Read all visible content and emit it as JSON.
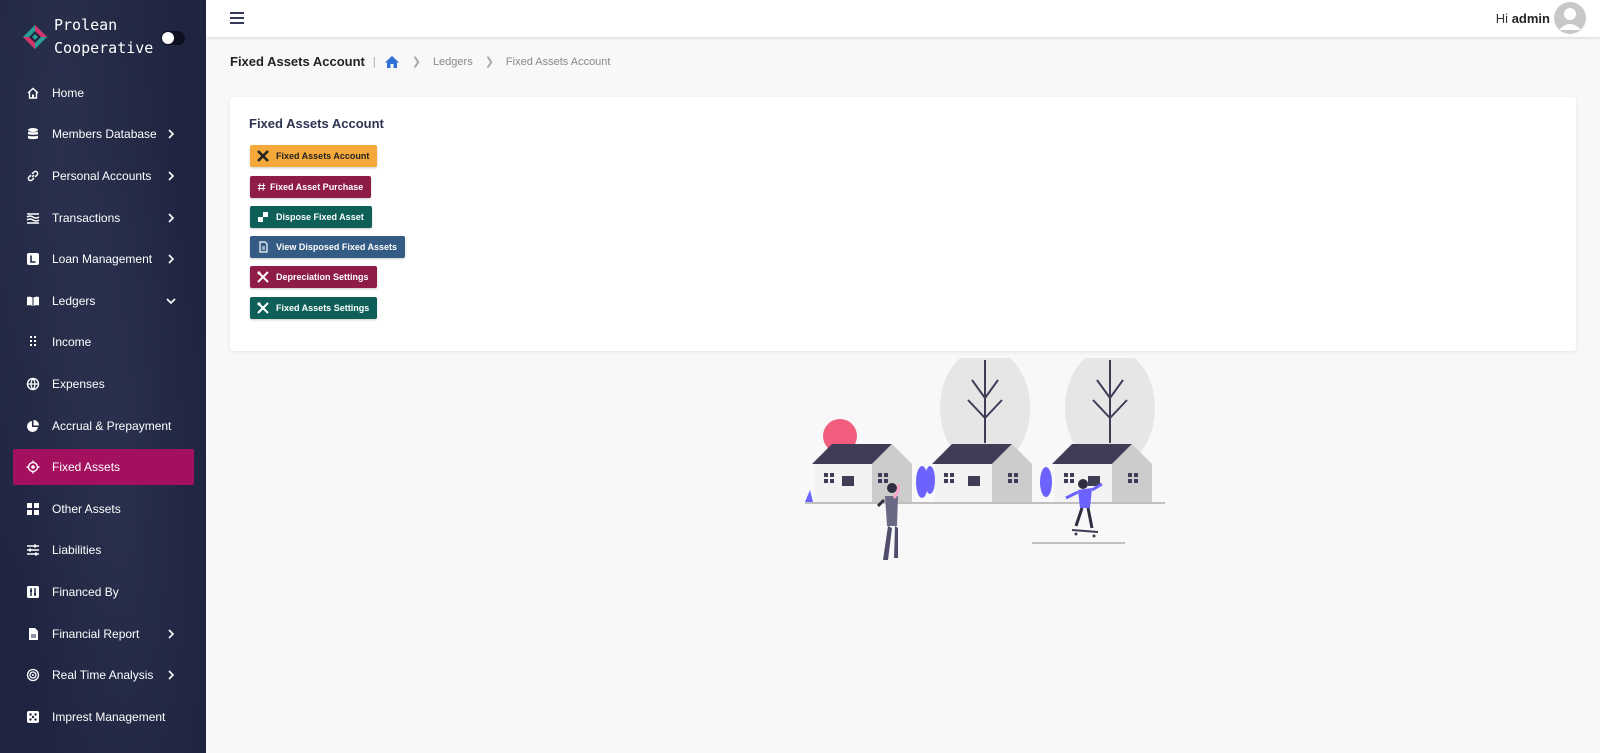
{
  "brand": {
    "line1": "Prolean",
    "line2": "Cooperative"
  },
  "sidebar": {
    "items": [
      {
        "label": "Home",
        "icon": "home-icon"
      },
      {
        "label": "Members Database",
        "icon": "database-icon",
        "chevron": "right"
      },
      {
        "label": "Personal Accounts",
        "icon": "link-icon",
        "chevron": "right"
      },
      {
        "label": "Transactions",
        "icon": "transactions-icon",
        "chevron": "right"
      },
      {
        "label": "Loan Management",
        "icon": "loan-icon",
        "chevron": "right"
      },
      {
        "label": "Ledgers",
        "icon": "book-icon",
        "chevron": "down"
      },
      {
        "label": "Income",
        "icon": "grid-dots-icon"
      },
      {
        "label": "Expenses",
        "icon": "globe-icon"
      },
      {
        "label": "Accrual & Prepayment",
        "icon": "pie-icon"
      },
      {
        "label": "Fixed Assets",
        "icon": "target-icon",
        "active": true
      },
      {
        "label": "Other Assets",
        "icon": "grid-icon"
      },
      {
        "label": "Liabilities",
        "icon": "sliders-icon"
      },
      {
        "label": "Financed By",
        "icon": "equalizer-icon"
      },
      {
        "label": "Financial Report",
        "icon": "report-icon",
        "chevron": "right"
      },
      {
        "label": "Real Time Analysis",
        "icon": "radar-icon",
        "chevron": "right"
      },
      {
        "label": "Imprest Management",
        "icon": "dice-icon"
      }
    ],
    "active_color": "#a3105e"
  },
  "header": {
    "greeting": "Hi",
    "user": "admin"
  },
  "breadcrumb": {
    "title": "Fixed Assets Account",
    "items": [
      "Ledgers",
      "Fixed Assets Account"
    ]
  },
  "card": {
    "title": "Fixed Assets Account",
    "buttons": [
      {
        "label": "Fixed Assets Account",
        "color": "#f6a93b",
        "text_color": "#222",
        "icon": "tools-cross-icon"
      },
      {
        "label": "Fixed Asset Purchase",
        "color": "#8e1c46",
        "text_color": "#fff",
        "icon": "hash-icon"
      },
      {
        "label": "Dispose Fixed Asset",
        "color": "#0f5f59",
        "text_color": "#fff",
        "icon": "blocks-icon"
      },
      {
        "label": "View Disposed Fixed Assets",
        "color": "#345b84",
        "text_color": "#fff",
        "icon": "document-icon"
      },
      {
        "label": "Depreciation Settings",
        "color": "#8e1c46",
        "text_color": "#fff",
        "icon": "wrench-screwdriver-icon"
      },
      {
        "label": "Fixed Assets Settings",
        "color": "#0f5f59",
        "text_color": "#fff",
        "icon": "wrench-screwdriver-icon"
      }
    ]
  }
}
